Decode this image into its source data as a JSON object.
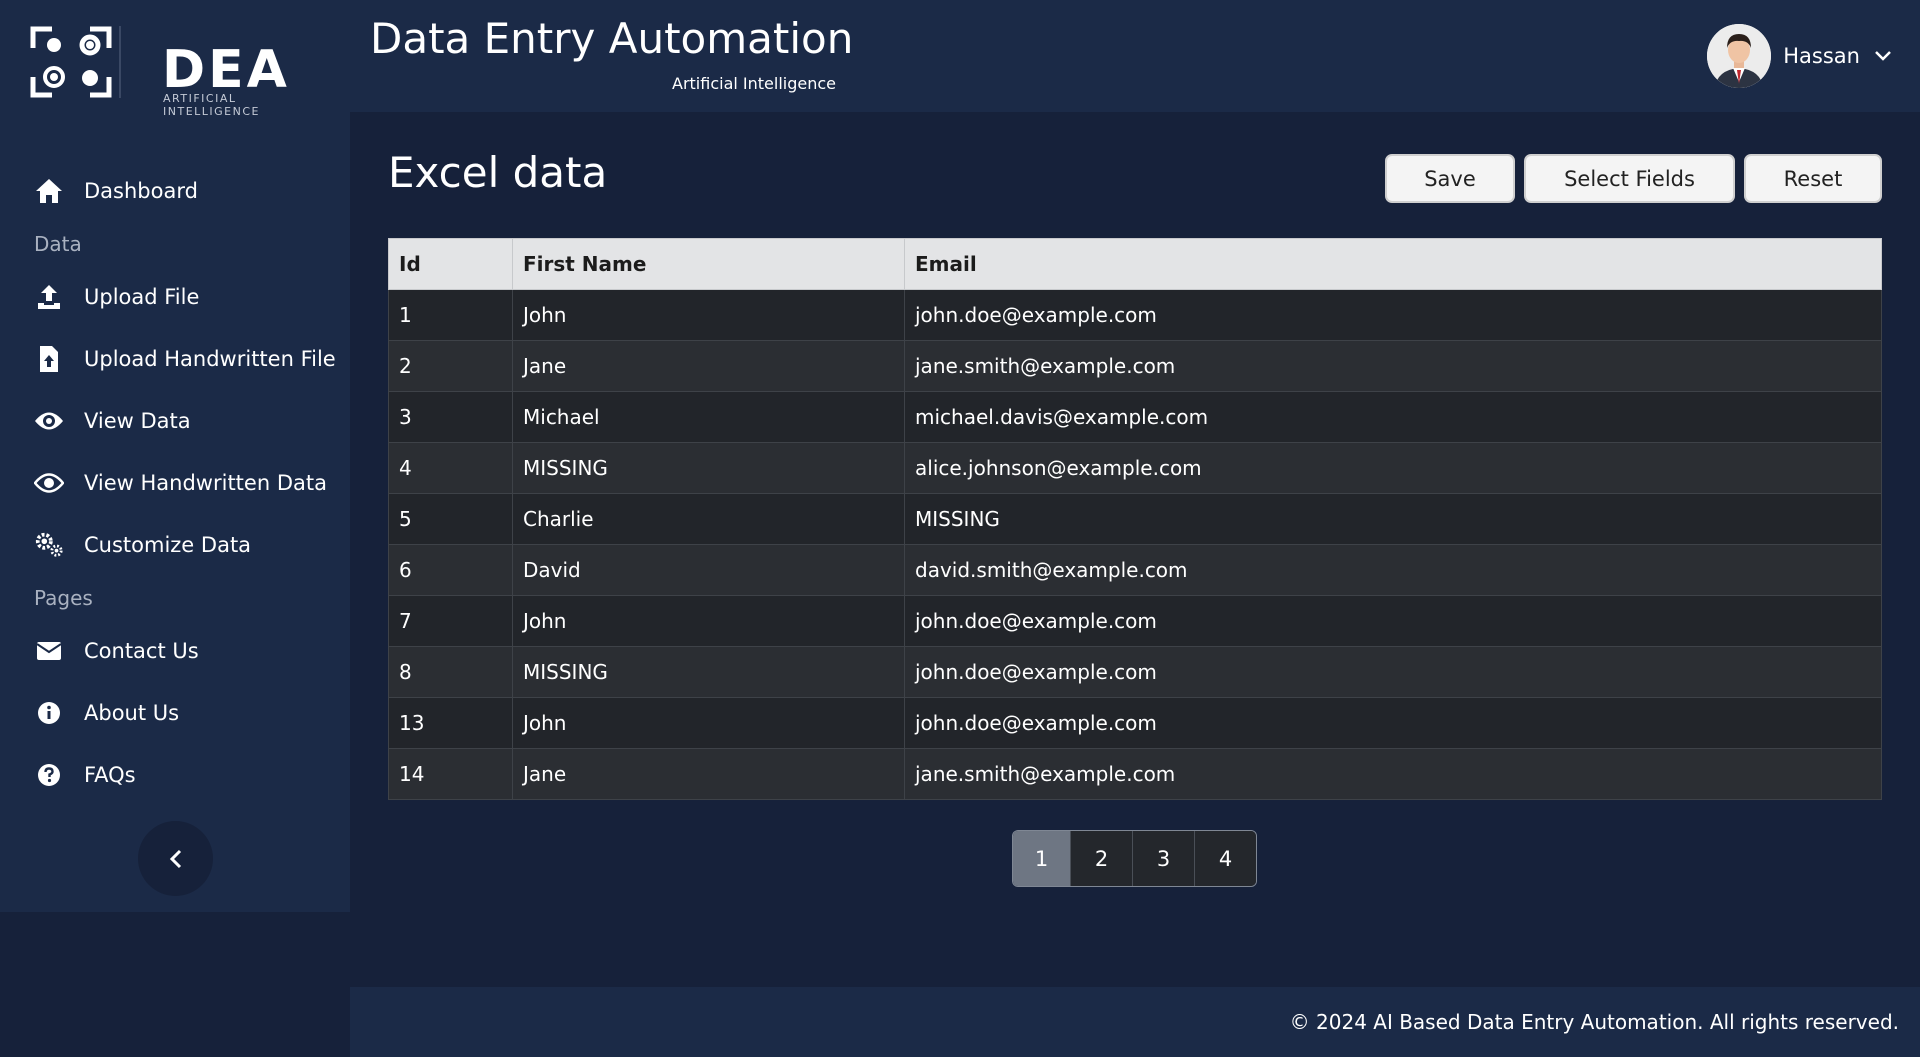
{
  "brand": {
    "logo_text": "DEA",
    "logo_subtext": "ARTIFICIAL INTELLIGENCE"
  },
  "header": {
    "title": "Data Entry Automation",
    "subtitle": "Artificial Intelligence",
    "user_name": "Hassan"
  },
  "sidebar": {
    "items": [
      {
        "label": "Dashboard",
        "icon": "home-icon"
      },
      {
        "label": "Upload File",
        "icon": "upload-icon"
      },
      {
        "label": "Upload Handwritten File",
        "icon": "file-upload-icon"
      },
      {
        "label": "View Data",
        "icon": "eye-icon"
      },
      {
        "label": "View Handwritten Data",
        "icon": "eye-icon"
      },
      {
        "label": "Customize Data",
        "icon": "gears-icon"
      },
      {
        "label": "Contact Us",
        "icon": "envelope-icon"
      },
      {
        "label": "About Us",
        "icon": "info-icon"
      },
      {
        "label": "FAQs",
        "icon": "question-icon"
      }
    ],
    "sections": {
      "data": "Data",
      "pages": "Pages"
    },
    "collapse_icon": "chevron-left-icon"
  },
  "main": {
    "title": "Excel data",
    "buttons": {
      "save": "Save",
      "select_fields": "Select Fields",
      "reset": "Reset"
    },
    "table": {
      "columns": [
        "Id",
        "First Name",
        "Email"
      ],
      "rows": [
        [
          "1",
          "John",
          "john.doe@example.com"
        ],
        [
          "2",
          "Jane",
          "jane.smith@example.com"
        ],
        [
          "3",
          "Michael",
          "michael.davis@example.com"
        ],
        [
          "4",
          "MISSING",
          "alice.johnson@example.com"
        ],
        [
          "5",
          "Charlie",
          "MISSING"
        ],
        [
          "6",
          "David",
          "david.smith@example.com"
        ],
        [
          "7",
          "John",
          "john.doe@example.com"
        ],
        [
          "8",
          "MISSING",
          "john.doe@example.com"
        ],
        [
          "13",
          "John",
          "john.doe@example.com"
        ],
        [
          "14",
          "Jane",
          "jane.smith@example.com"
        ]
      ]
    },
    "pagination": {
      "pages": [
        "1",
        "2",
        "3",
        "4"
      ],
      "current": "1"
    }
  },
  "footer": {
    "text": "© 2024 AI Based Data Entry Automation. All rights reserved."
  },
  "colors": {
    "background": "#16213a",
    "panel": "#1b2a47",
    "table_header": "#e3e4e6",
    "active_page": "#6e7683"
  }
}
